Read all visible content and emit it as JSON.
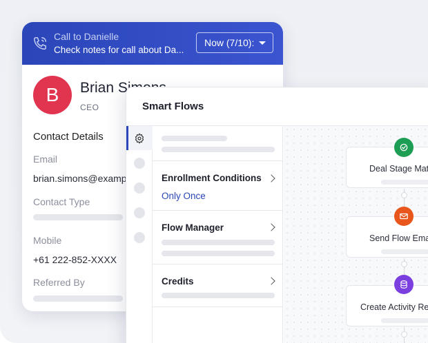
{
  "call_banner": {
    "title": "Call to Danielle",
    "subtitle": "Check notes for call about Da...",
    "dropdown_value": "Now (7/10):"
  },
  "contact": {
    "avatar_initial": "B",
    "name": "Brian Simons",
    "role": "CEO",
    "section_title": "Contact Details",
    "email_label": "Email",
    "email_value": "brian.simons@example.com",
    "contact_type_label": "Contact Type",
    "mobile_label": "Mobile",
    "mobile_value": "+61 222-852-XXXX",
    "referred_by_label": "Referred By"
  },
  "smart_flows": {
    "title": "Smart Flows",
    "menu": [
      {
        "label": "Enrollment Conditions",
        "value": "Only Once"
      },
      {
        "label": "Flow Manager"
      },
      {
        "label": "Credits"
      }
    ],
    "nodes": [
      {
        "label": "Deal Stage Matches",
        "icon": "deal-stage-icon",
        "color": "#1e9e55"
      },
      {
        "label": "Send Flow Email",
        "icon": "email-icon",
        "color": "#e8561c"
      },
      {
        "label": "Create Activity Record",
        "icon": "database-icon",
        "color": "#7b3fe0"
      }
    ]
  },
  "colors": {
    "brand": "#2a46b8",
    "avatar": "#e0344f"
  }
}
